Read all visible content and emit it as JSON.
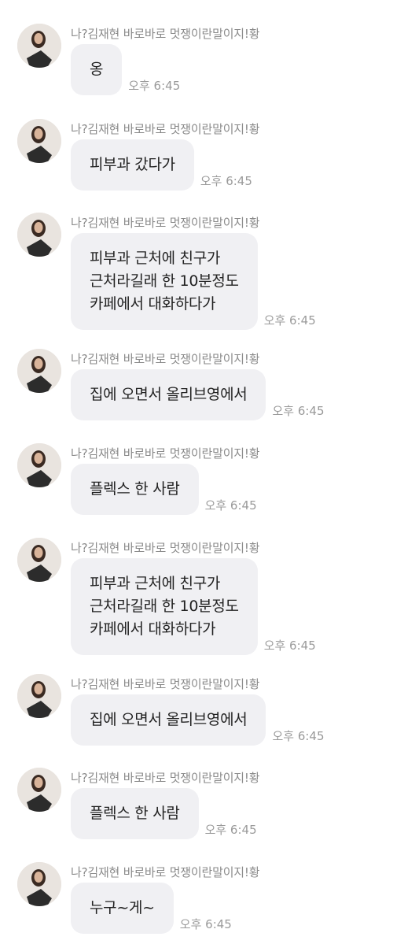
{
  "chat": {
    "messages": [
      {
        "sender": "나?김재현 바로바로 멋쟁이란말이지!황",
        "text": "옹",
        "time": "오후 6:45"
      },
      {
        "sender": "나?김재현 바로바로 멋쟁이란말이지!황",
        "text": "피부과 갔다가",
        "time": "오후 6:45"
      },
      {
        "sender": "나?김재현 바로바로 멋쟁이란말이지!황",
        "text": "피부과 근처에 친구가\n근처라길래 한 10분정도\n카페에서 대화하다가",
        "time": "오후 6:45"
      },
      {
        "sender": "나?김재현 바로바로 멋쟁이란말이지!황",
        "text": "집에 오면서 올리브영에서",
        "time": "오후 6:45"
      },
      {
        "sender": "나?김재현 바로바로 멋쟁이란말이지!황",
        "text": "플렉스 한 사람",
        "time": "오후 6:45"
      },
      {
        "sender": "나?김재현 바로바로 멋쟁이란말이지!황",
        "text": "피부과 근처에 친구가\n근처라길래 한 10분정도\n카페에서 대화하다가",
        "time": "오후 6:45"
      },
      {
        "sender": "나?김재현 바로바로 멋쟁이란말이지!황",
        "text": "집에 오면서 올리브영에서",
        "time": "오후 6:45"
      },
      {
        "sender": "나?김재현 바로바로 멋쟁이란말이지!황",
        "text": "플렉스 한 사람",
        "time": "오후 6:45"
      },
      {
        "sender": "나?김재현 바로바로 멋쟁이란말이지!황",
        "text": "누구~게~",
        "time": "오후 6:45"
      }
    ]
  }
}
